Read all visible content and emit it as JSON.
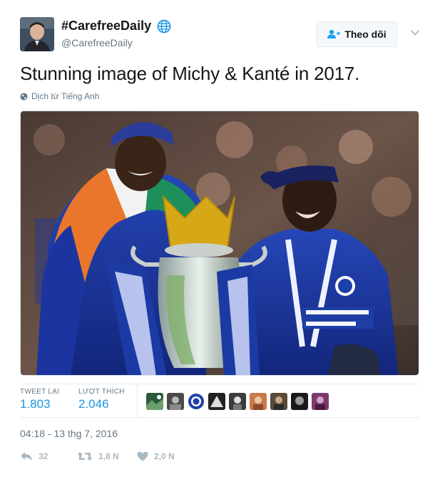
{
  "author": {
    "display_name": "#CarefreeDaily",
    "handle": "@CarefreeDaily"
  },
  "follow_button": {
    "label": "Theo dõi"
  },
  "tweet": {
    "text": "Stunning image of Michy & Kanté in 2017.",
    "translate_label": "Dịch từ Tiếng Anh"
  },
  "stats": {
    "retweets_label": "TWEET LẠI",
    "retweets_value": "1.803",
    "likes_label": "LƯỢT THÍCH",
    "likes_value": "2.046"
  },
  "timestamp": "04:18 - 13 thg 7, 2016",
  "actions": {
    "reply_count": "32",
    "retweet_count": "1,8 N",
    "like_count": "2,0 N"
  },
  "colors": {
    "accent": "#1b95e0",
    "muted": "#657786",
    "icon_gray": "#aab8c2",
    "chelsea_blue": "#1d3fa8"
  },
  "icons": [
    "globe-icon",
    "follow-person-icon",
    "chevron-down-icon",
    "reply-icon",
    "retweet-icon",
    "heart-icon"
  ]
}
